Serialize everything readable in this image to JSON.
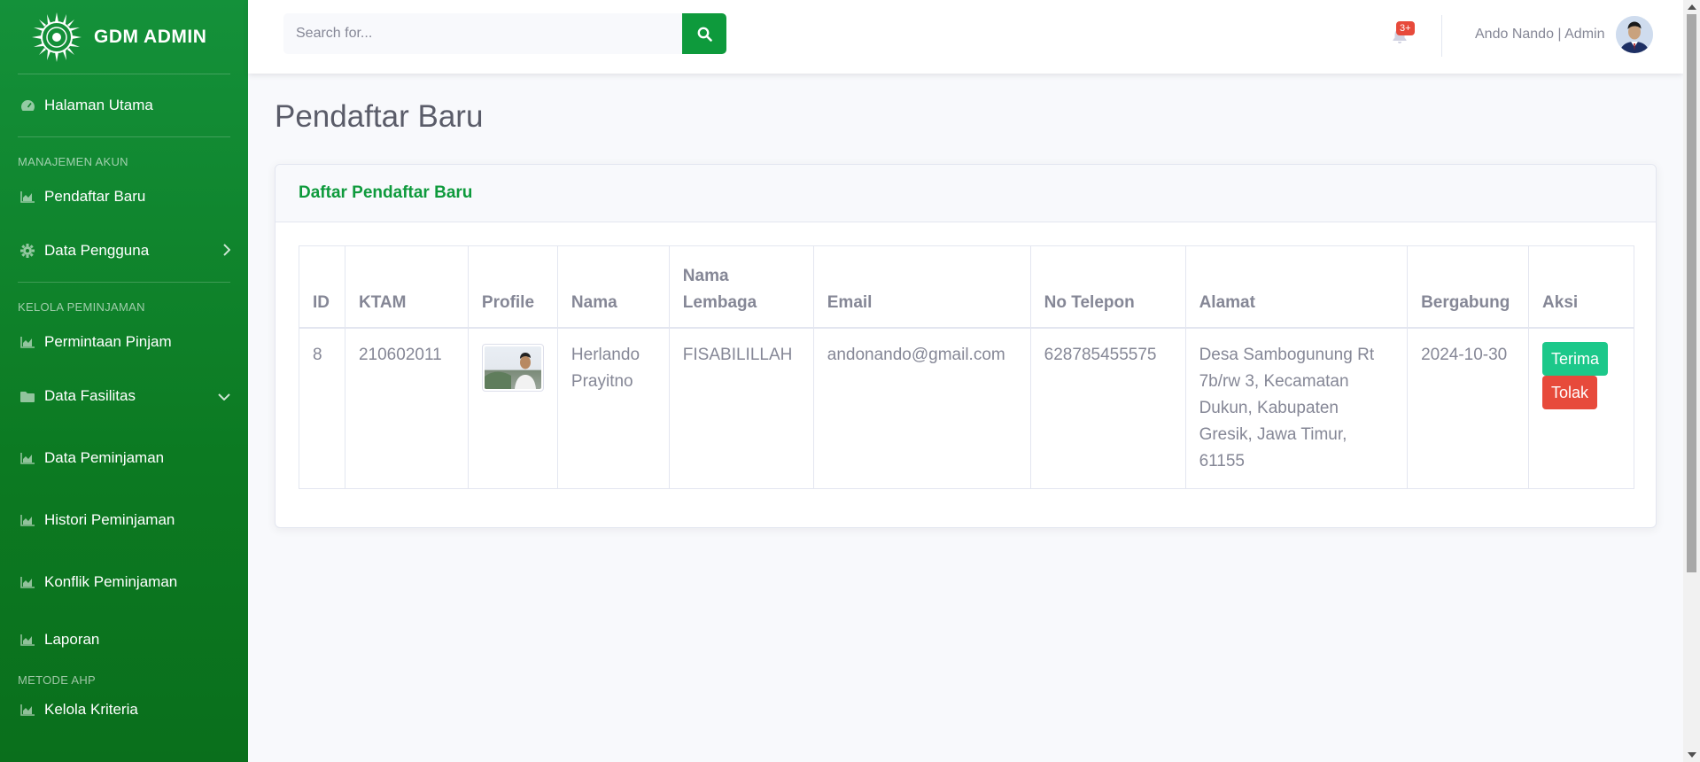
{
  "brand": {
    "name": "GDM ADMIN"
  },
  "sidebar": {
    "home": "Halaman Utama",
    "sections": [
      {
        "heading": "MANAJEMEN AKUN"
      },
      {
        "heading": "KELOLA PEMINJAMAN"
      },
      {
        "heading": "METODE AHP"
      }
    ],
    "items": [
      {
        "label": "Pendaftar Baru",
        "icon": "chart-area-icon"
      },
      {
        "label": "Data Pengguna",
        "icon": "cog-icon"
      },
      {
        "label": "Permintaan Pinjam",
        "icon": "chart-area-icon"
      },
      {
        "label": "Data Fasilitas",
        "icon": "folder-icon"
      },
      {
        "label": "Data Peminjaman",
        "icon": "chart-area-icon"
      },
      {
        "label": "Histori Peminjaman",
        "icon": "chart-area-icon"
      },
      {
        "label": "Konflik Peminjaman",
        "icon": "chart-area-icon"
      },
      {
        "label": "Laporan",
        "icon": "chart-area-icon"
      },
      {
        "label": "Kelola Kriteria",
        "icon": "chart-area-icon"
      }
    ]
  },
  "topbar": {
    "search_placeholder": "Search for...",
    "notification_count": "3+",
    "user_label": "Ando Nando | Admin"
  },
  "page": {
    "title": "Pendaftar Baru",
    "card_title": "Daftar Pendaftar Baru"
  },
  "table": {
    "headers": [
      "ID",
      "KTAM",
      "Profile",
      "Nama",
      "Nama Lembaga",
      "Email",
      "No Telepon",
      "Alamat",
      "Bergabung",
      "Aksi"
    ],
    "rows": [
      {
        "id": "8",
        "ktam": "210602011",
        "nama": "Herlando Prayitno",
        "lembaga": "FISABILILLAH",
        "email": "andonando@gmail.com",
        "telepon": "628785455575",
        "alamat": "Desa Sambogunung Rt 7b/rw 3, Kecamatan Dukun, Kabupaten Gresik, Jawa Timur, 61155",
        "bergabung": "2024-10-30",
        "accept_label": "Terima",
        "reject_label": "Tolak"
      }
    ]
  },
  "colors": {
    "primary": "#0e9a3c",
    "sidebar": "#0c7a22",
    "success": "#1cc88a",
    "danger": "#e74a3b"
  }
}
